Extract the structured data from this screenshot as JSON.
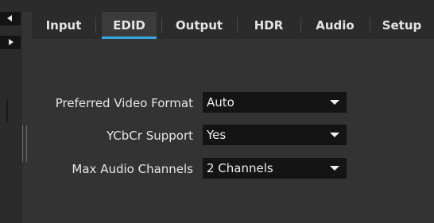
{
  "tabs": [
    {
      "label": "Input",
      "active": false
    },
    {
      "label": "EDID",
      "active": true
    },
    {
      "label": "Output",
      "active": false
    },
    {
      "label": "HDR",
      "active": false
    },
    {
      "label": "Audio",
      "active": false
    },
    {
      "label": "Setup",
      "active": false
    }
  ],
  "settings": [
    {
      "label": "Preferred Video Format",
      "value": "Auto"
    },
    {
      "label": "YCbCr Support",
      "value": "Yes"
    },
    {
      "label": "Max Audio Channels",
      "value": "2 Channels"
    }
  ],
  "colors": {
    "accent": "#3aa4df",
    "background": "#333333",
    "dropdown": "#141414"
  },
  "icons": {
    "scroll_left": "triangle-left",
    "scroll_right": "triangle-right",
    "dropdown": "triangle-down"
  }
}
